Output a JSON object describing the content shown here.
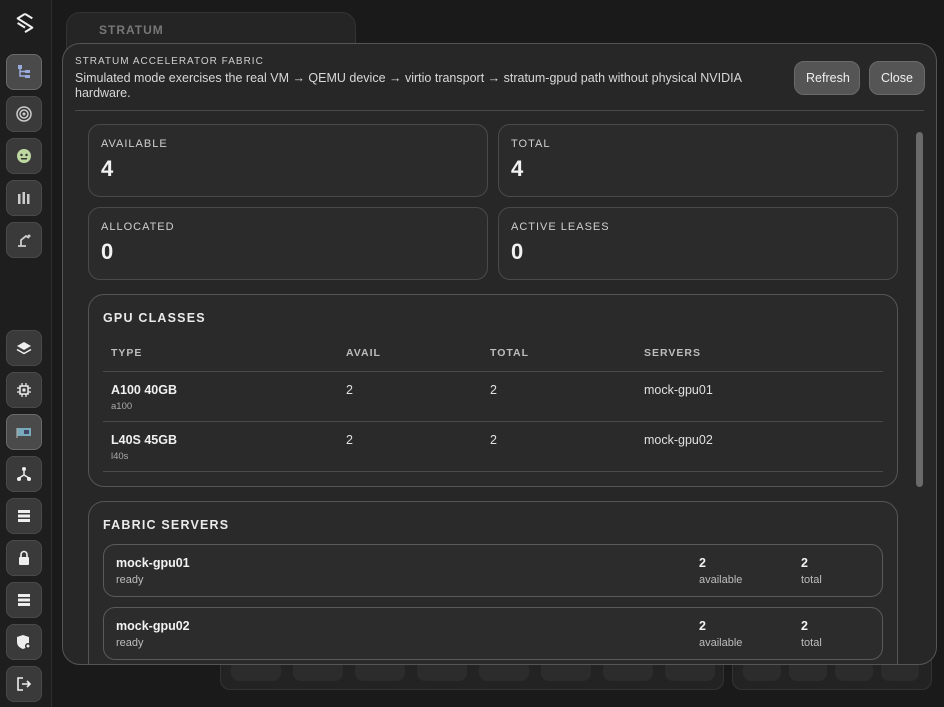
{
  "background": {
    "card_title": "STRATUM"
  },
  "sidebar": {
    "icons": [
      "stratum-logo-icon",
      "hierarchy-icon",
      "target-icon",
      "robot-icon",
      "bottles-icon",
      "robot-arm-icon",
      "layers-icon",
      "chip-icon",
      "gpu-card-icon",
      "network-icon",
      "list-icon",
      "lock-icon",
      "list-icon",
      "shield-user-icon",
      "logout-icon"
    ]
  },
  "modal": {
    "eyebrow": "STRATUM ACCELERATOR FABRIC",
    "subtitle": "Simulated mode exercises the real VM → QEMU device → virtio transport → stratum-gpud path without physical NVIDIA hardware.",
    "refresh_label": "Refresh",
    "close_label": "Close"
  },
  "stats": [
    {
      "label": "AVAILABLE",
      "value": "4"
    },
    {
      "label": "TOTAL",
      "value": "4"
    },
    {
      "label": "ALLOCATED",
      "value": "0"
    },
    {
      "label": "ACTIVE LEASES",
      "value": "0"
    }
  ],
  "gpu_classes": {
    "title": "GPU CLASSES",
    "columns": [
      "TYPE",
      "AVAIL",
      "TOTAL",
      "SERVERS"
    ],
    "rows": [
      {
        "name": "A100 40GB",
        "id": "a100",
        "avail": "2",
        "total": "2",
        "servers": "mock-gpu01"
      },
      {
        "name": "L40S 45GB",
        "id": "l40s",
        "avail": "2",
        "total": "2",
        "servers": "mock-gpu02"
      }
    ]
  },
  "fabric_servers": {
    "title": "FABRIC SERVERS",
    "items": [
      {
        "name": "mock-gpu01",
        "status": "ready",
        "available": "2",
        "available_label": "available",
        "total": "2",
        "total_label": "total"
      },
      {
        "name": "mock-gpu02",
        "status": "ready",
        "available": "2",
        "available_label": "available",
        "total": "2",
        "total_label": "total"
      }
    ]
  },
  "colors": {
    "background": "#1a1a1a",
    "panel": "#272727",
    "border": "#555555",
    "button": "#555555"
  }
}
